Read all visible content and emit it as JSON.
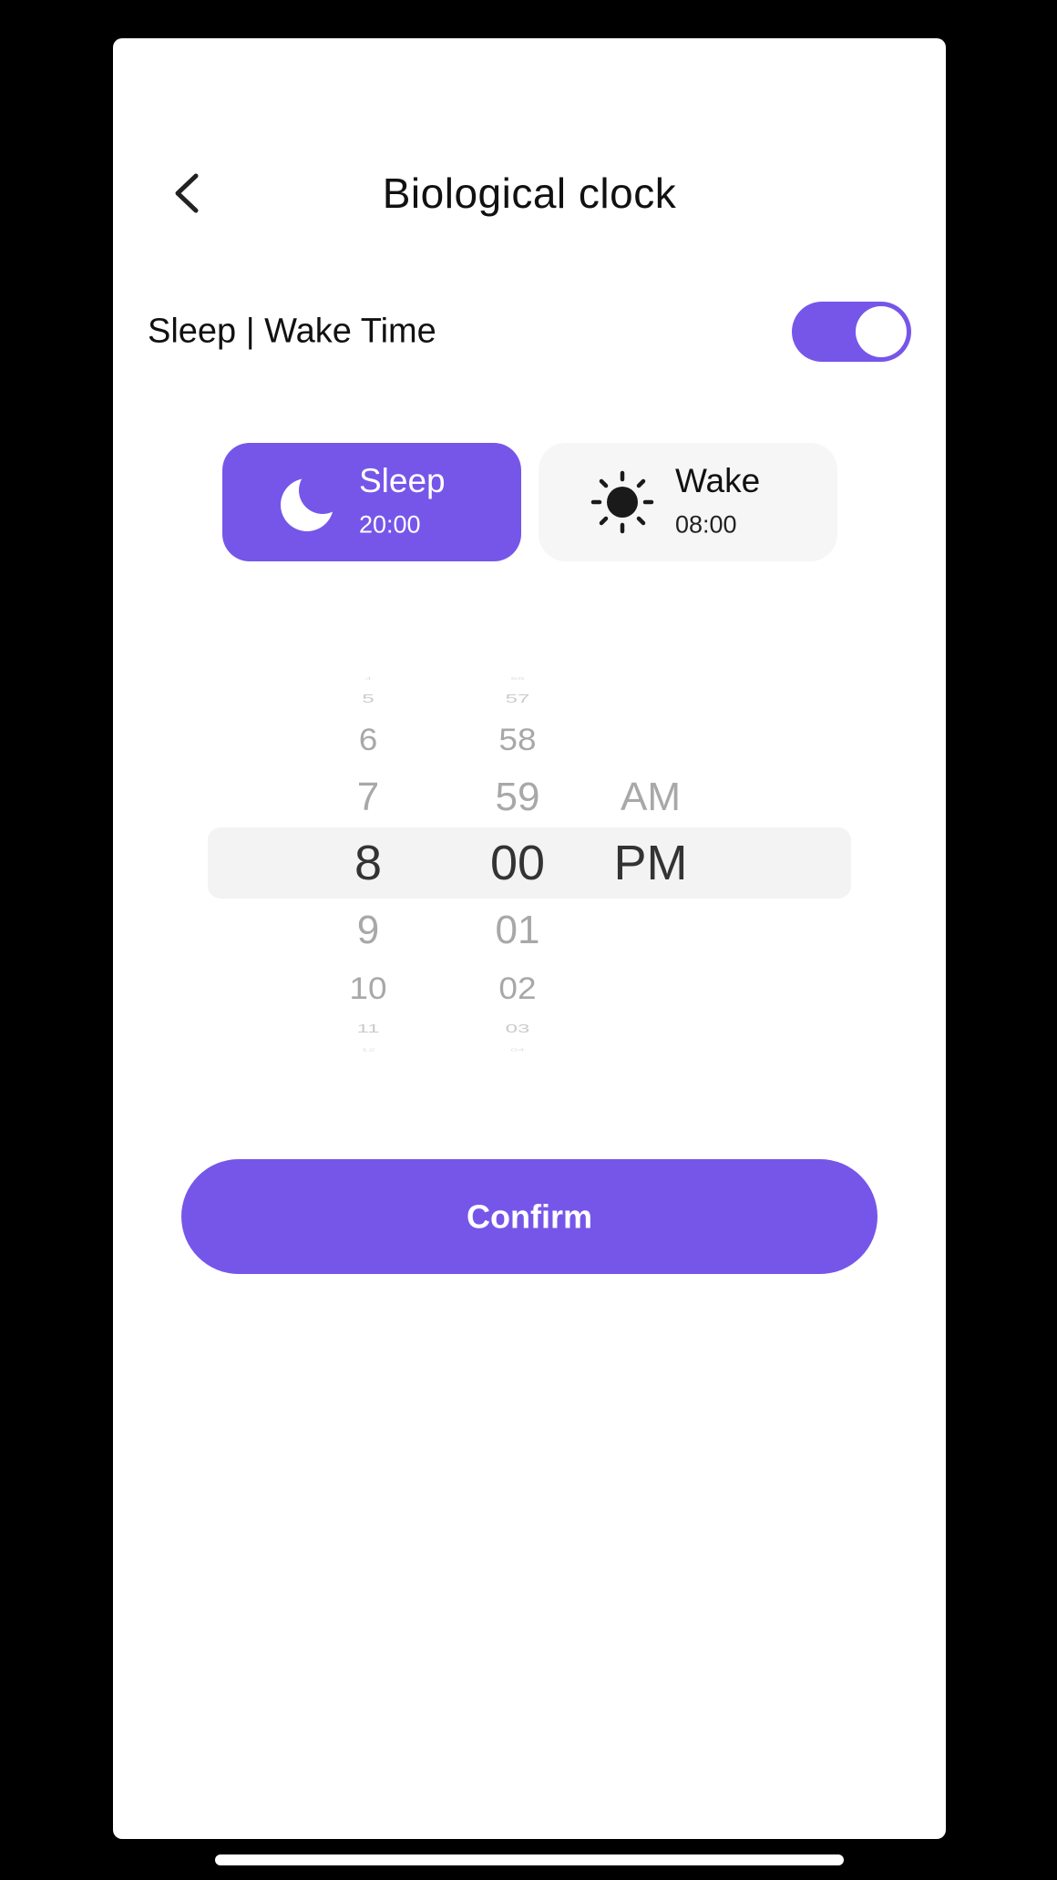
{
  "header": {
    "title": "Biological clock"
  },
  "toggle_row": {
    "label": "Sleep | Wake Time",
    "enabled": true
  },
  "segments": {
    "sleep": {
      "name": "Sleep",
      "time": "20:00",
      "selected": true
    },
    "wake": {
      "name": "Wake",
      "time": "08:00",
      "selected": false
    }
  },
  "picker": {
    "hours": [
      "4",
      "5",
      "6",
      "7",
      "8",
      "9",
      "10",
      "11",
      "12"
    ],
    "minutes": [
      "56",
      "57",
      "58",
      "59",
      "00",
      "01",
      "02",
      "03",
      "04"
    ],
    "ampm": [
      "AM",
      "PM"
    ],
    "selected": {
      "hour": "8",
      "minute": "00",
      "ampm": "PM"
    }
  },
  "confirm_label": "Confirm",
  "colors": {
    "accent": "#7656e9",
    "text_primary": "#111111",
    "picker_faded": "#a8a8a8",
    "segment_inactive_bg": "#f6f6f6",
    "picker_highlight_bg": "#f3f3f3"
  },
  "icons": {
    "back": "chevron-left-icon",
    "sleep": "moon-icon",
    "wake": "sun-icon"
  }
}
